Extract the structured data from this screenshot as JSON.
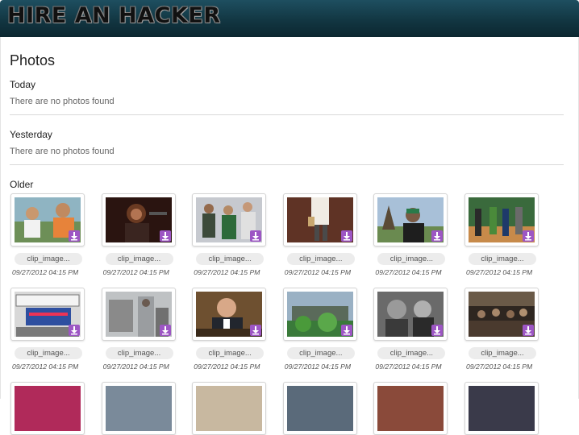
{
  "header": {
    "logo_text": "HIRE AN HACKER"
  },
  "page": {
    "title": "Photos"
  },
  "sections": {
    "today": {
      "title": "Today",
      "empty_text": "There are no photos found"
    },
    "yesterday": {
      "title": "Yesterday",
      "empty_text": "There are no photos found"
    },
    "older": {
      "title": "Older"
    }
  },
  "colors": {
    "header_bg": "#123642",
    "download_badge": "#9d56c4"
  },
  "photos": [
    {
      "name": "clip_image...",
      "date": "09/27/2012 04:15 PM",
      "scene": "two boys outdoors"
    },
    {
      "name": "clip_image...",
      "date": "09/27/2012 04:15 PM",
      "scene": "singer with microphone"
    },
    {
      "name": "clip_image...",
      "date": "09/27/2012 04:15 PM",
      "scene": "crowd at event"
    },
    {
      "name": "clip_image...",
      "date": "09/27/2012 04:15 PM",
      "scene": "person walking"
    },
    {
      "name": "clip_image...",
      "date": "09/27/2012 04:15 PM",
      "scene": "man in cap under trees"
    },
    {
      "name": "clip_image...",
      "date": "09/27/2012 04:15 PM",
      "scene": "group on sports court"
    },
    {
      "name": "clip_image...",
      "date": "09/27/2012 04:15 PM",
      "scene": "bookstore information center sign"
    },
    {
      "name": "clip_image...",
      "date": "09/27/2012 04:15 PM",
      "scene": "street scene"
    },
    {
      "name": "clip_image...",
      "date": "09/27/2012 04:15 PM",
      "scene": "man in suit at table"
    },
    {
      "name": "clip_image...",
      "date": "09/27/2012 04:15 PM",
      "scene": "house with plants"
    },
    {
      "name": "clip_image...",
      "date": "09/27/2012 04:15 PM",
      "scene": "two people smiling"
    },
    {
      "name": "clip_image...",
      "date": "09/27/2012 04:15 PM",
      "scene": "people in a room"
    },
    {
      "scene": "partial photo"
    },
    {
      "scene": "partial photo"
    },
    {
      "scene": "partial photo"
    },
    {
      "scene": "partial photo"
    },
    {
      "scene": "partial photo"
    },
    {
      "scene": "partial photo"
    }
  ]
}
